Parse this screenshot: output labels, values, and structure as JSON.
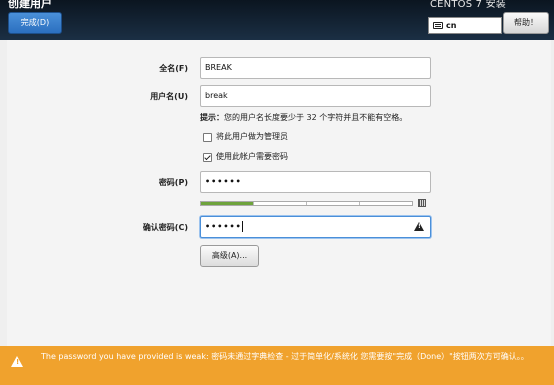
{
  "header": {
    "page_title": "创建用户",
    "done_label": "完成(D)",
    "install_title": "CENTOS 7 安装",
    "keyboard_layout": "cn",
    "help_label": "帮助！"
  },
  "form": {
    "fullname_label": "全名(F)",
    "fullname_value": "BREAK",
    "username_label": "用户名(U)",
    "username_value": "break",
    "hint_prefix": "提示：",
    "hint_text": "您的用户名长度要少于 32 个字符并且不能有空格。",
    "admin_checkbox_label": "将此用户做为管理员",
    "admin_checked": false,
    "require_password_label": "使用此帐户需要密码",
    "require_password_checked": true,
    "password_label": "密码(P)",
    "password_value": "••••••",
    "strength_fraction": 0.25,
    "confirm_label": "确认密码(C)",
    "confirm_value": "••••••",
    "advanced_label": "高级(A)..."
  },
  "warning": {
    "text": "The password you have provided is weak: 密码未通过字典检查 - 过于简单化/系统化 您需要按\"完成（Done）\"按钮两次方可确认。。",
    "color": "#f0a22d"
  }
}
